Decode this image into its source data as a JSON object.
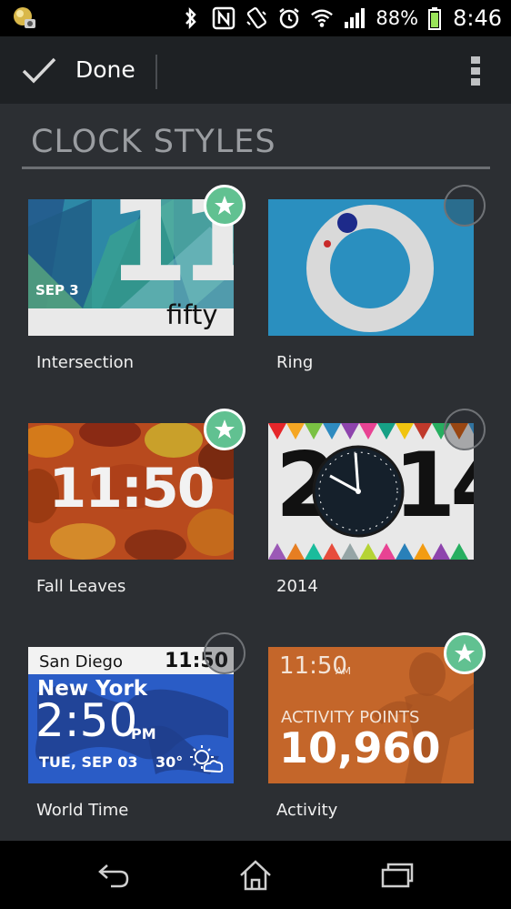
{
  "status_bar": {
    "battery_percent": "88%",
    "time": "8:46",
    "icons": [
      "notification-icon",
      "bluetooth-icon",
      "nfc-icon",
      "vibrate-icon",
      "alarm-icon",
      "wifi-icon",
      "signal-icon",
      "battery-icon"
    ]
  },
  "action_bar": {
    "done_label": "Done",
    "icons": [
      "check-icon",
      "overflow-menu-icon"
    ]
  },
  "section": {
    "title": "CLOCK STYLES"
  },
  "clock_styles": [
    {
      "name": "Intersection",
      "selected": true,
      "preview": {
        "date": "SEP 3",
        "hour": "11",
        "minutes_word": "fifty"
      }
    },
    {
      "name": "Ring",
      "selected": false
    },
    {
      "name": "Fall Leaves",
      "selected": true,
      "preview": {
        "time": "11:50"
      }
    },
    {
      "name": "2014",
      "selected": false,
      "preview": {
        "year_left": "2",
        "year_right": "14"
      }
    },
    {
      "name": "World Time",
      "selected": false,
      "preview": {
        "local_city": "San Diego",
        "local_time": "11:50",
        "remote_city": "New York",
        "remote_time": "2:50",
        "remote_ampm": "PM",
        "date": "TUE, SEP 03",
        "temperature": "30°"
      }
    },
    {
      "name": "Activity",
      "selected": true,
      "preview": {
        "time": "11:50",
        "ampm": "AM",
        "label": "ACTIVITY POINTS",
        "points": "10,960"
      }
    }
  ],
  "colors": {
    "background": "#2c2f33",
    "action_bar": "#1e2124",
    "badge_selected": "#61c191"
  },
  "nav_bar": {
    "icons": [
      "back-icon",
      "home-icon",
      "recent-apps-icon"
    ]
  }
}
